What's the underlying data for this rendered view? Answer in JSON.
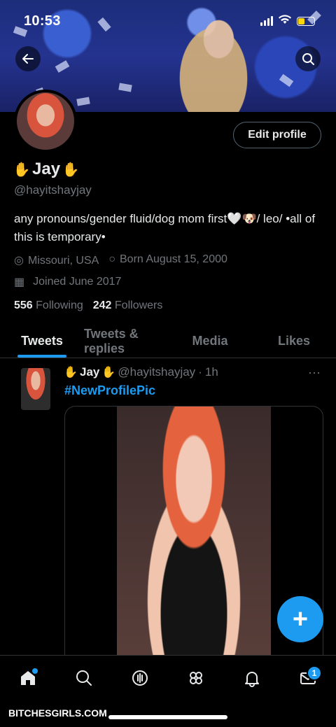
{
  "status_bar": {
    "time": "10:53",
    "battery_level": 0.4,
    "battery_color": "#ffd60a"
  },
  "header": {
    "back_icon": "arrow-left-icon",
    "search_icon": "search-icon"
  },
  "profile": {
    "edit_button_label": "Edit profile",
    "display_name": "Jay",
    "handle": "@hayitshayjay",
    "bio": "any pronouns/gender fluid/dog mom first🤍🐶/ leo/ •all of this is temporary•",
    "location": "Missouri, USA",
    "birthday": "Born August 15, 2000",
    "joined": "Joined June 2017",
    "following_count": "556",
    "following_label": "Following",
    "followers_count": "242",
    "followers_label": "Followers",
    "name_emoji": "hamsa"
  },
  "tabs": [
    {
      "label": "Tweets",
      "active": true
    },
    {
      "label": "Tweets & replies",
      "active": false
    },
    {
      "label": "Media",
      "active": false
    },
    {
      "label": "Likes",
      "active": false
    }
  ],
  "tweet": {
    "author": "Jay",
    "handle": "@hayitshayjay",
    "separator": "·",
    "time": "1h",
    "more": "···",
    "text": "#NewProfilePic"
  },
  "fab": {
    "label": "+"
  },
  "bottom_nav": {
    "items": [
      "home-icon",
      "search-icon",
      "spaces-icon",
      "communities-icon",
      "notifications-icon",
      "messages-icon"
    ],
    "messages_badge": "1"
  },
  "watermark": "BITCHESGIRLS.COM",
  "colors": {
    "accent": "#1d9bf0",
    "text": "#e7e9ea",
    "muted": "#71767b",
    "border": "#2f3336"
  }
}
